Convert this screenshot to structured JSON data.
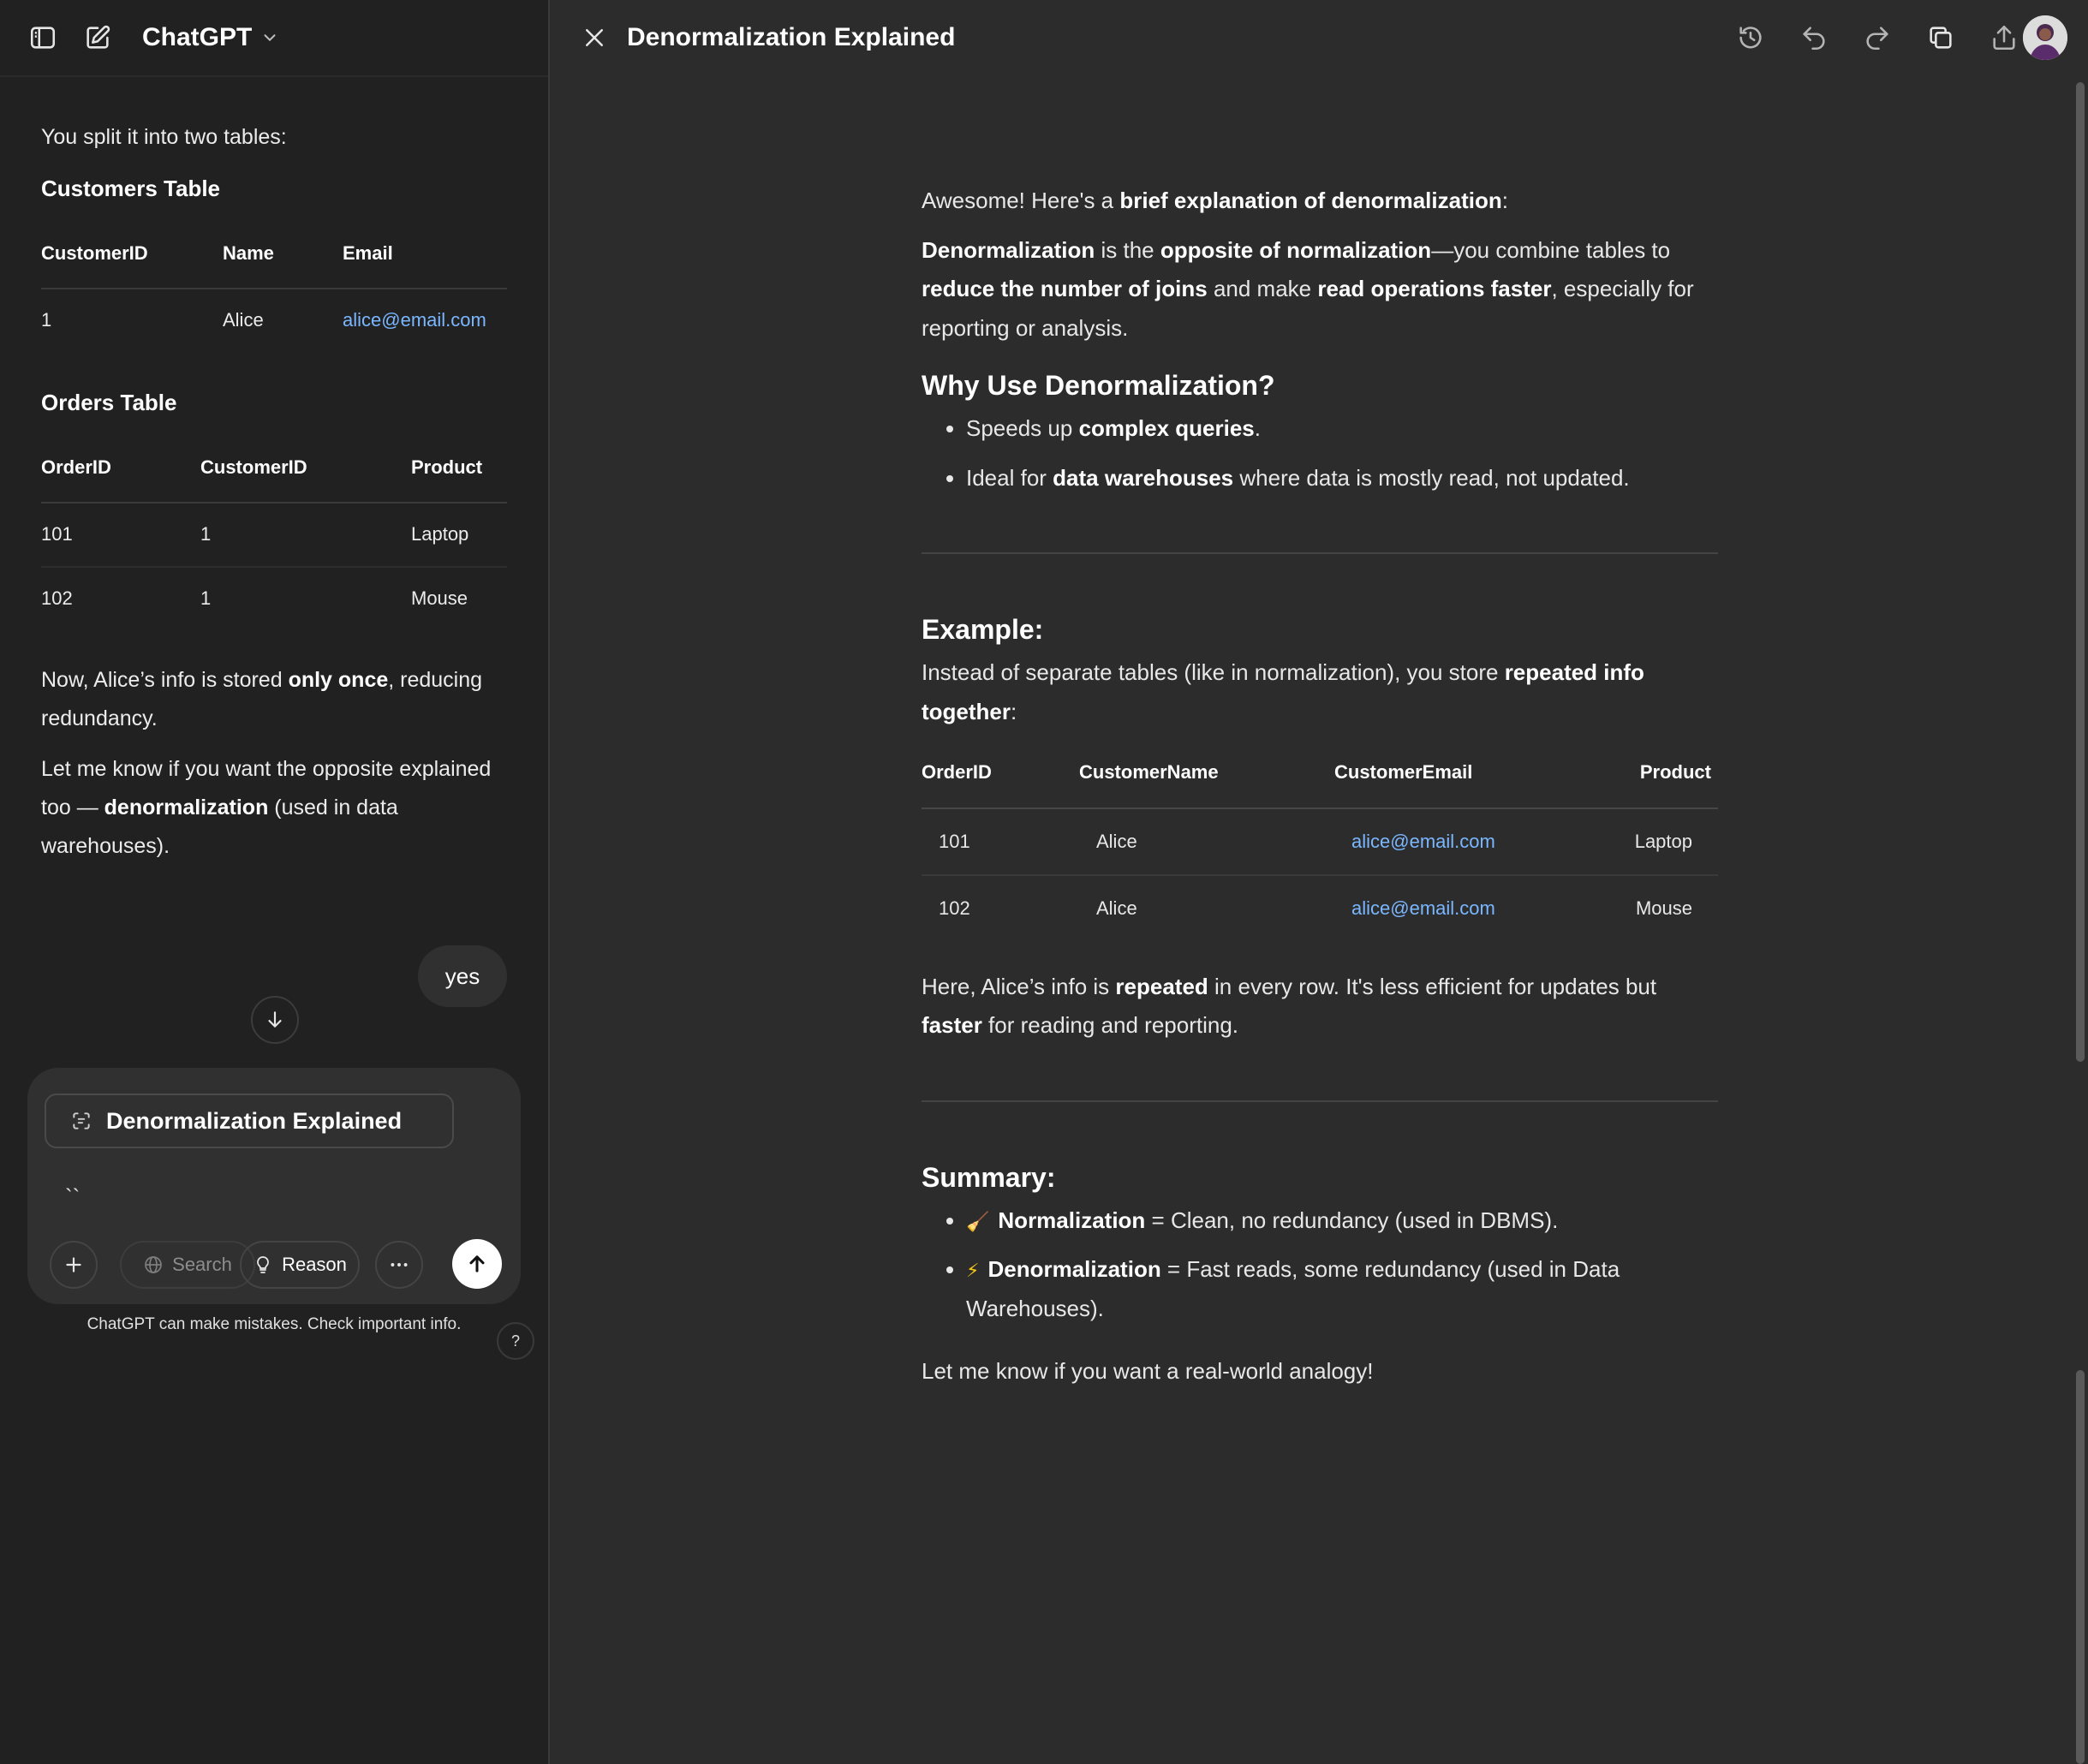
{
  "left": {
    "header": {
      "model_name": "ChatGPT"
    },
    "intro": "You split it into two tables:",
    "customers_table": {
      "heading": "Customers Table",
      "columns": [
        "CustomerID",
        "Name",
        "Email"
      ],
      "rows": [
        [
          "1",
          "Alice",
          "alice@email.com"
        ]
      ]
    },
    "orders_table": {
      "heading": "Orders Table",
      "columns": [
        "OrderID",
        "CustomerID",
        "Product"
      ],
      "rows": [
        [
          "101",
          "1",
          "Laptop"
        ],
        [
          "102",
          "1",
          "Mouse"
        ]
      ]
    },
    "para1": {
      "prefix": "Now, Alice’s info is stored ",
      "bold": "only once",
      "suffix": ", reducing redundancy."
    },
    "para2": {
      "prefix": "Let me know if you want the opposite explained too — ",
      "bold": "denormalization",
      "suffix": " (used in data warehouses)."
    },
    "user_message": "yes",
    "composer": {
      "canvas_chip": "Denormalization Explained",
      "typed_text": "``",
      "search_label": "Search",
      "reason_label": "Reason"
    },
    "disclaimer": "ChatGPT can make mistakes. Check important info.",
    "help_label": "?"
  },
  "canvas": {
    "title": "Denormalization Explained",
    "intro": {
      "prefix": "Awesome! Here's a ",
      "bold": "brief explanation of denormalization",
      "suffix": ":"
    },
    "definition": {
      "b1": "Denormalization",
      "t1": " is the ",
      "b2": "opposite of normalization",
      "t2": "—you combine tables to ",
      "b3": "reduce the number of joins",
      "t3": " and make ",
      "b4": "read operations faster",
      "t4": ", especially for reporting or analysis."
    },
    "why_heading": "Why Use Denormalization?",
    "why_items": [
      {
        "prefix": "Speeds up ",
        "bold": "complex queries",
        "suffix": "."
      },
      {
        "prefix": "Ideal for ",
        "bold": "data warehouses",
        "suffix": " where data is mostly read, not updated."
      }
    ],
    "example_heading": "Example:",
    "example_intro": {
      "prefix": "Instead of separate tables (like in normalization), you store ",
      "bold": "repeated info together",
      "suffix": ":"
    },
    "example_table": {
      "columns": [
        "OrderID",
        "CustomerName",
        "CustomerEmail",
        "Product"
      ],
      "rows": [
        [
          "101",
          "Alice",
          "alice@email.com",
          "Laptop"
        ],
        [
          "102",
          "Alice",
          "alice@email.com",
          "Mouse"
        ]
      ]
    },
    "example_note": {
      "t1": "Here, Alice’s info is ",
      "b1": "repeated",
      "t2": " in every row. It's less efficient for updates but ",
      "b2": "faster",
      "t3": " for reading and reporting."
    },
    "summary_heading": "Summary:",
    "summary_items": [
      {
        "emoji": "🧹",
        "bold": "Normalization",
        "suffix": " = Clean, no redundancy (used in DBMS)."
      },
      {
        "emoji": "⚡",
        "bold": "Denormalization",
        "suffix": " = Fast reads, some redundancy (used in Data Warehouses)."
      }
    ],
    "closing": "Let me know if you want a real-world analogy!"
  },
  "icons": {
    "left_header": [
      "sidebar-toggle-icon",
      "new-chat-icon",
      "chevron-down-icon"
    ],
    "right_header": [
      "close-icon",
      "version-history-icon",
      "undo-icon",
      "redo-icon",
      "copy-icon",
      "share-icon"
    ],
    "composer": [
      "canvas-icon",
      "plus-icon",
      "globe-icon",
      "lightbulb-icon",
      "more-icon",
      "arrow-up-icon"
    ]
  },
  "colors": {
    "link": "#7ab7ff",
    "background": "#212121",
    "canvas_background": "#2c2c2c"
  }
}
